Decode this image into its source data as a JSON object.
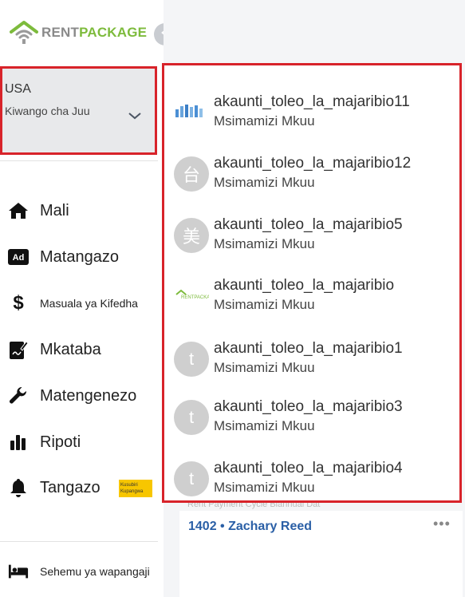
{
  "brand": {
    "rent": "RENT",
    "package": "PACKAGE"
  },
  "region": {
    "country": "USA",
    "level": "Kiwango cha Juu"
  },
  "nav": {
    "items": [
      {
        "label": "Mali",
        "icon": "home-icon"
      },
      {
        "label": "Matangazo",
        "icon": "ad-icon"
      },
      {
        "label": "Masuala ya Kifedha",
        "icon": "dollar-icon"
      },
      {
        "label": "Mkataba",
        "icon": "contract-icon"
      },
      {
        "label": "Matengenezo",
        "icon": "wrench-icon"
      },
      {
        "label": "Ripoti",
        "icon": "bar-chart-icon"
      },
      {
        "label": "Tangazo",
        "icon": "bell-icon",
        "badge": "Kusubiri Kupangwa"
      }
    ],
    "bottom": {
      "label": "Sehemu ya wapangaji",
      "icon": "bed-icon"
    }
  },
  "accounts": [
    {
      "name": "akaunti_toleo_la_majaribio11",
      "role": "Msimamizi Mkuu",
      "avatar": "image"
    },
    {
      "name": "akaunti_toleo_la_majaribio12",
      "role": "Msimamizi Mkuu",
      "avatar": "台"
    },
    {
      "name": "akaunti_toleo_la_majaribio5",
      "role": "Msimamizi Mkuu",
      "avatar": "美"
    },
    {
      "name": "akaunti_toleo_la_majaribio",
      "role": "Msimamizi Mkuu",
      "avatar": "image"
    },
    {
      "name": "akaunti_toleo_la_majaribio1",
      "role": "Msimamizi Mkuu",
      "avatar": "t"
    },
    {
      "name": "akaunti_toleo_la_majaribio3",
      "role": "Msimamizi Mkuu",
      "avatar": "t"
    },
    {
      "name": "akaunti_toleo_la_majaribio4",
      "role": "Msimamizi Mkuu",
      "avatar": "t"
    }
  ],
  "card": {
    "tenant": "1402 • Zachary Reed",
    "more": "•••",
    "ghost": "Rent Payment Cycle  Biannual Dat"
  },
  "colors": {
    "accent_green": "#7dbb3c",
    "highlight_red": "#d8232a",
    "link_blue": "#2a5fa6",
    "badge_yellow": "#f7c600"
  }
}
